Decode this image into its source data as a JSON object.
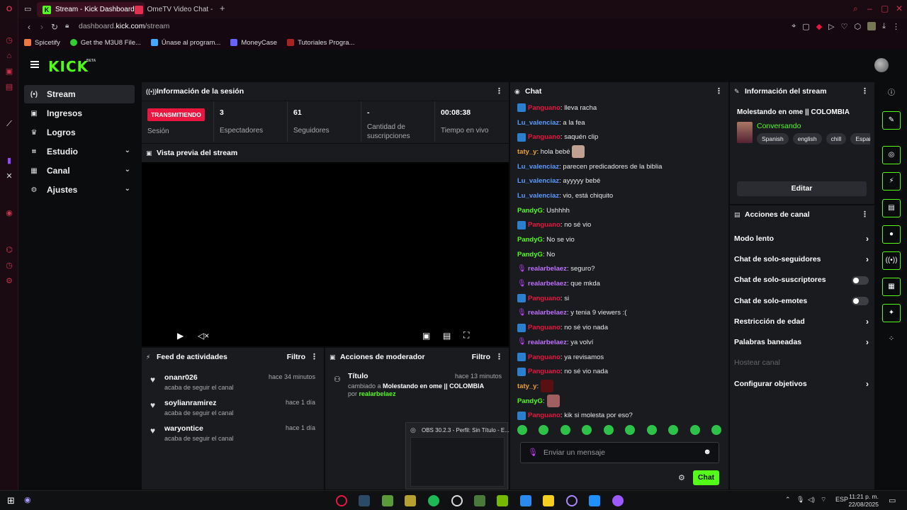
{
  "browser": {
    "tabs": [
      {
        "label": "Stream - Kick Dashboard"
      },
      {
        "label": "OmeTV Video Chat -..."
      }
    ],
    "url_domain": "dashboard.",
    "url_host": "kick.com",
    "url_path": "/stream",
    "bookmarks": [
      "Spicetify",
      "Get the M3U8 File...",
      "Únase al program...",
      "MoneyCase",
      "Tutoriales Progra..."
    ]
  },
  "app": {
    "logo": "KICK",
    "beta": "BETA",
    "nav": [
      {
        "label": "Stream",
        "icon": "broadcast-icon"
      },
      {
        "label": "Ingresos",
        "icon": "wallet-icon"
      },
      {
        "label": "Logros",
        "icon": "trophy-icon"
      },
      {
        "label": "Estudio",
        "icon": "studio-icon"
      },
      {
        "label": "Canal",
        "icon": "channel-icon"
      },
      {
        "label": "Ajustes",
        "icon": "gear-icon"
      }
    ]
  },
  "session": {
    "title": "Información de la sesión",
    "badge": "TRANSMITIENDO",
    "badge_label": "Sesión",
    "stats": [
      {
        "value": "3",
        "label": "Espectadores"
      },
      {
        "value": "61",
        "label": "Seguidores"
      },
      {
        "value": "-",
        "label": "Cantidad de suscripciones"
      },
      {
        "value": "00:08:38",
        "label": "Tiempo en vivo"
      }
    ]
  },
  "preview": {
    "title": "Vista previa del stream"
  },
  "feed": {
    "title": "Feed de actividades",
    "filter": "Filtro",
    "items": [
      {
        "name": "onanr026",
        "sub": "acaba de seguir el canal",
        "time": "hace 34 minutos"
      },
      {
        "name": "soylianramirez",
        "sub": "acaba de seguir el canal",
        "time": "hace 1 día"
      },
      {
        "name": "waryontice",
        "sub": "acaba de seguir el canal",
        "time": "hace 1 día"
      }
    ]
  },
  "mod": {
    "title": "Acciones de moderador",
    "filter": "Filtro",
    "item_title": "Título",
    "item_time": "hace 13 minutos",
    "item_prefix": "cambiado a",
    "item_value": "Molestando en ome || COLOMBIA",
    "item_by": "por",
    "item_user": "realarbelaez"
  },
  "chat": {
    "title": "Chat",
    "messages": [
      {
        "user": "Panguano",
        "color": "#e91640",
        "badge": "blue",
        "text": ": lleva racha"
      },
      {
        "user": "Lu_valenciaz",
        "color": "#5b9bff",
        "badge": "",
        "text": ": a la fea"
      },
      {
        "user": "Panguano",
        "color": "#e91640",
        "badge": "blue",
        "text": ": saquén clip"
      },
      {
        "user": "taty_y",
        "color": "#f0a030",
        "badge": "",
        "text": ": hola bebé",
        "emoji": "#c0a090"
      },
      {
        "user": "Lu_valenciaz",
        "color": "#5b9bff",
        "badge": "",
        "text": ": parecen predicadores de la biblia"
      },
      {
        "user": "Lu_valenciaz",
        "color": "#5b9bff",
        "badge": "",
        "text": ": ayyyyy bebé"
      },
      {
        "user": "Lu_valenciaz",
        "color": "#5b9bff",
        "badge": "",
        "text": ": vio, está chiquito"
      },
      {
        "user": "PandyG",
        "color": "#53fc18",
        "badge": "",
        "text": ": Ushhhh"
      },
      {
        "user": "Panguano",
        "color": "#e91640",
        "badge": "blue",
        "text": ": no sé vio"
      },
      {
        "user": "PandyG",
        "color": "#53fc18",
        "badge": "",
        "text": ": No se vio"
      },
      {
        "user": "PandyG",
        "color": "#53fc18",
        "badge": "",
        "text": ": No"
      },
      {
        "user": "realarbelaez",
        "color": "#c070ff",
        "badge": "mic",
        "text": ": seguro?"
      },
      {
        "user": "realarbelaez",
        "color": "#c070ff",
        "badge": "mic",
        "text": ": que mkda"
      },
      {
        "user": "Panguano",
        "color": "#e91640",
        "badge": "blue",
        "text": ": si"
      },
      {
        "user": "realarbelaez",
        "color": "#c070ff",
        "badge": "mic",
        "text": ": y tenia 9 viewers :("
      },
      {
        "user": "Panguano",
        "color": "#e91640",
        "badge": "blue",
        "text": ": no sé vio nada"
      },
      {
        "user": "realarbelaez",
        "color": "#c070ff",
        "badge": "mic",
        "text": ": ya volví"
      },
      {
        "user": "Panguano",
        "color": "#e91640",
        "badge": "blue",
        "text": ": ya revisamos"
      },
      {
        "user": "Panguano",
        "color": "#e91640",
        "badge": "blue",
        "text": ": no sé vio nada"
      },
      {
        "user": "taty_y",
        "color": "#f0a030",
        "badge": "",
        "text": ":",
        "emoji": "#5a1010"
      },
      {
        "user": "PandyG",
        "color": "#53fc18",
        "badge": "",
        "text": ":",
        "emoji": "#a06060"
      },
      {
        "user": "Panguano",
        "color": "#e91640",
        "badge": "blue",
        "text": ": kik si molesta por eso?"
      }
    ],
    "placeholder": "Enviar un mensaje",
    "send": "Chat"
  },
  "streaminfo": {
    "title": "Información del stream",
    "stream_title": "Molestando en ome || COLOMBIA",
    "category": "Conversando",
    "tags": [
      "Spanish",
      "english",
      "chill",
      "Españo"
    ],
    "edit": "Editar"
  },
  "channel_actions": {
    "title": "Acciones de canal",
    "items": [
      {
        "label": "Modo lento",
        "kind": "arrow"
      },
      {
        "label": "Chat de solo-seguidores",
        "kind": "arrow"
      },
      {
        "label": "Chat de solo-suscriptores",
        "kind": "toggle"
      },
      {
        "label": "Chat de solo-emotes",
        "kind": "toggle"
      },
      {
        "label": "Restricción de edad",
        "kind": "arrow"
      },
      {
        "label": "Palabras baneadas",
        "kind": "arrow"
      },
      {
        "label": "Hostear canal",
        "kind": "dim"
      },
      {
        "label": "Configurar objetivos",
        "kind": "arrow"
      }
    ]
  },
  "popup": {
    "title": "OBS 30.2.3 - Perfil: Sin Título - E..."
  },
  "taskbar": {
    "lang": "ESP",
    "time": "11:21 p. m.",
    "date": "22/08/2025"
  },
  "colors": {
    "accent": "#53fc18",
    "live": "#e91640",
    "panel": "#191b1f"
  }
}
